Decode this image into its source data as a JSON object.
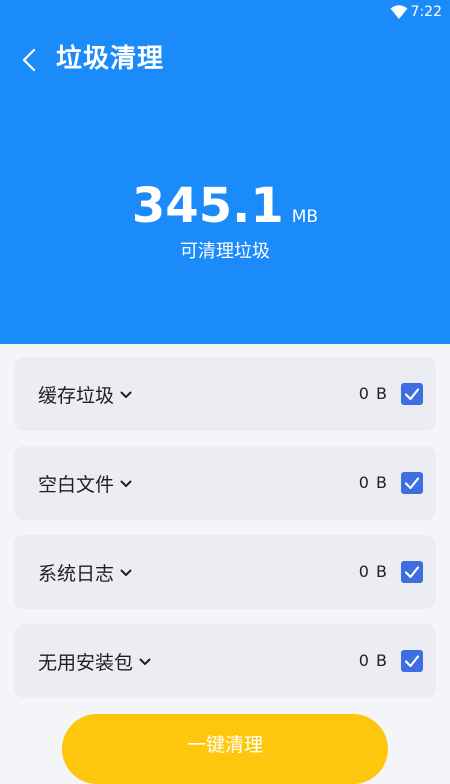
{
  "status_bar": {
    "time": "7:22",
    "wifi_icon": "wifi-icon"
  },
  "header": {
    "title": "垃圾清理",
    "back_icon": "chevron-left-icon",
    "total_size": "345.1",
    "total_unit": "MB",
    "caption": "可清理垃圾"
  },
  "items": [
    {
      "label": "缓存垃圾",
      "size": "0 B",
      "checked": true
    },
    {
      "label": "空白文件",
      "size": "0 B",
      "checked": true
    },
    {
      "label": "系统日志",
      "size": "0 B",
      "checked": true
    },
    {
      "label": "无用安装包",
      "size": "0 B",
      "checked": true
    }
  ],
  "action": {
    "clean_label": "一键清理"
  },
  "colors": {
    "header_bg": "#1C8BFA",
    "card_bg": "#ECEDF2",
    "checkbox": "#3D6FE0",
    "button": "#FFC60E",
    "page_bg": "#F4F5F9"
  }
}
